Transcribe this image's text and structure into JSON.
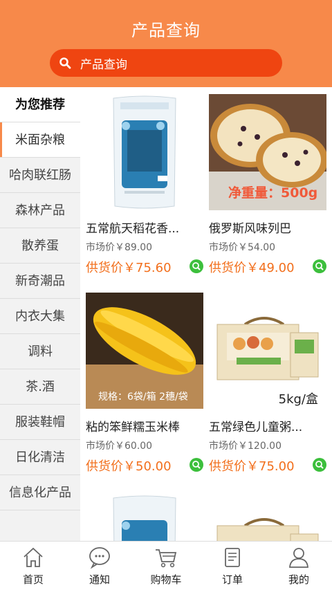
{
  "header": {
    "title": "产品查询"
  },
  "search": {
    "placeholder": "产品查询"
  },
  "sidebar": {
    "heading": "为您推荐",
    "items": [
      {
        "label": "米面杂粮",
        "active": true
      },
      {
        "label": "哈肉联红肠"
      },
      {
        "label": "森林产品"
      },
      {
        "label": "散养蛋"
      },
      {
        "label": "新奇潮品"
      },
      {
        "label": "内衣大集"
      },
      {
        "label": "调料"
      },
      {
        "label": "茶.酒"
      },
      {
        "label": "服装鞋帽"
      },
      {
        "label": "日化清洁"
      },
      {
        "label": "信息化产品"
      }
    ]
  },
  "products": [
    {
      "name": "五常航天稻花香...",
      "market_price": "市场价￥89.00",
      "supply_price": "供货价￥75.60"
    },
    {
      "name": "俄罗斯风味列巴",
      "market_price": "市场价￥54.00",
      "supply_price": "供货价￥49.00",
      "image_text": "净重量：500g"
    },
    {
      "name": "粘的笨鲜糯玉米棒",
      "market_price": "市场价￥60.00",
      "supply_price": "供货价￥50.00",
      "image_text": "规格：6袋/箱 2穗/袋"
    },
    {
      "name": "五常绿色儿童粥...",
      "market_price": "市场价￥120.00",
      "supply_price": "供货价￥75.00",
      "image_text": "5kg/盒"
    }
  ],
  "tabbar": {
    "home": "首页",
    "notice": "通知",
    "cart": "购物车",
    "orders": "订单",
    "mine": "我的"
  }
}
